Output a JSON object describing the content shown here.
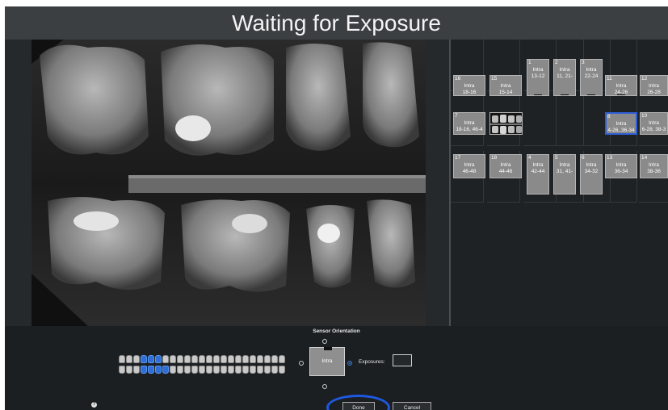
{
  "header": {
    "title": "Waiting for Exposure"
  },
  "grid": {
    "tiles": [
      {
        "num": "16",
        "label": "Intra",
        "range": "18-16",
        "pos": "r0c0"
      },
      {
        "num": "15",
        "label": "Intra",
        "range": "15-14",
        "pos": "r0c1"
      },
      {
        "num": "1",
        "label": "Intra",
        "range": "13-12",
        "pos": "r0c2"
      },
      {
        "num": "2",
        "label": "Intra",
        "range": "11, 21-",
        "pos": "r0c3"
      },
      {
        "num": "3",
        "label": "Intra",
        "range": "22-24",
        "pos": "r0c4"
      },
      {
        "num": "11",
        "label": "Intra",
        "range": "24-26",
        "pos": "r0c5"
      },
      {
        "num": "12",
        "label": "Intra",
        "range": "26-28",
        "pos": "r0c6"
      },
      {
        "num": "7",
        "label": "Intra",
        "range": "18-16, 46-4",
        "pos": "r1c0"
      },
      {
        "num": "8",
        "label": "Intra",
        "range": "4-26, 36-34",
        "pos": "r1c5",
        "selected": true
      },
      {
        "num": "10",
        "label": "Intra",
        "range": "6-28, 38-3",
        "pos": "r1c6"
      },
      {
        "num": "17",
        "label": "Intra",
        "range": "46-48",
        "pos": "r2c0"
      },
      {
        "num": "18",
        "label": "Intra",
        "range": "44-46",
        "pos": "r2c1"
      },
      {
        "num": "4",
        "label": "Intra",
        "range": "42-44",
        "pos": "r2c2"
      },
      {
        "num": "5",
        "label": "Intra",
        "range": "31, 41-",
        "pos": "r2c3"
      },
      {
        "num": "6",
        "label": "Intra",
        "range": "34-32",
        "pos": "r2c4"
      },
      {
        "num": "13",
        "label": "Intra",
        "range": "36-34",
        "pos": "r2c5"
      },
      {
        "num": "14",
        "label": "Intra",
        "range": "38-36",
        "pos": "r2c6"
      }
    ]
  },
  "sensor": {
    "title": "Sensor Orientation",
    "box_label": "Intra",
    "exposures_label": "Exposures:",
    "exposures_value": ""
  },
  "buttons": {
    "done": "Done",
    "cancel": "Cancel"
  },
  "help": {
    "glyph": "?"
  },
  "colors": {
    "accent": "#2f5fd6",
    "tile": "#8a8a8a",
    "background": "#1d2124"
  }
}
